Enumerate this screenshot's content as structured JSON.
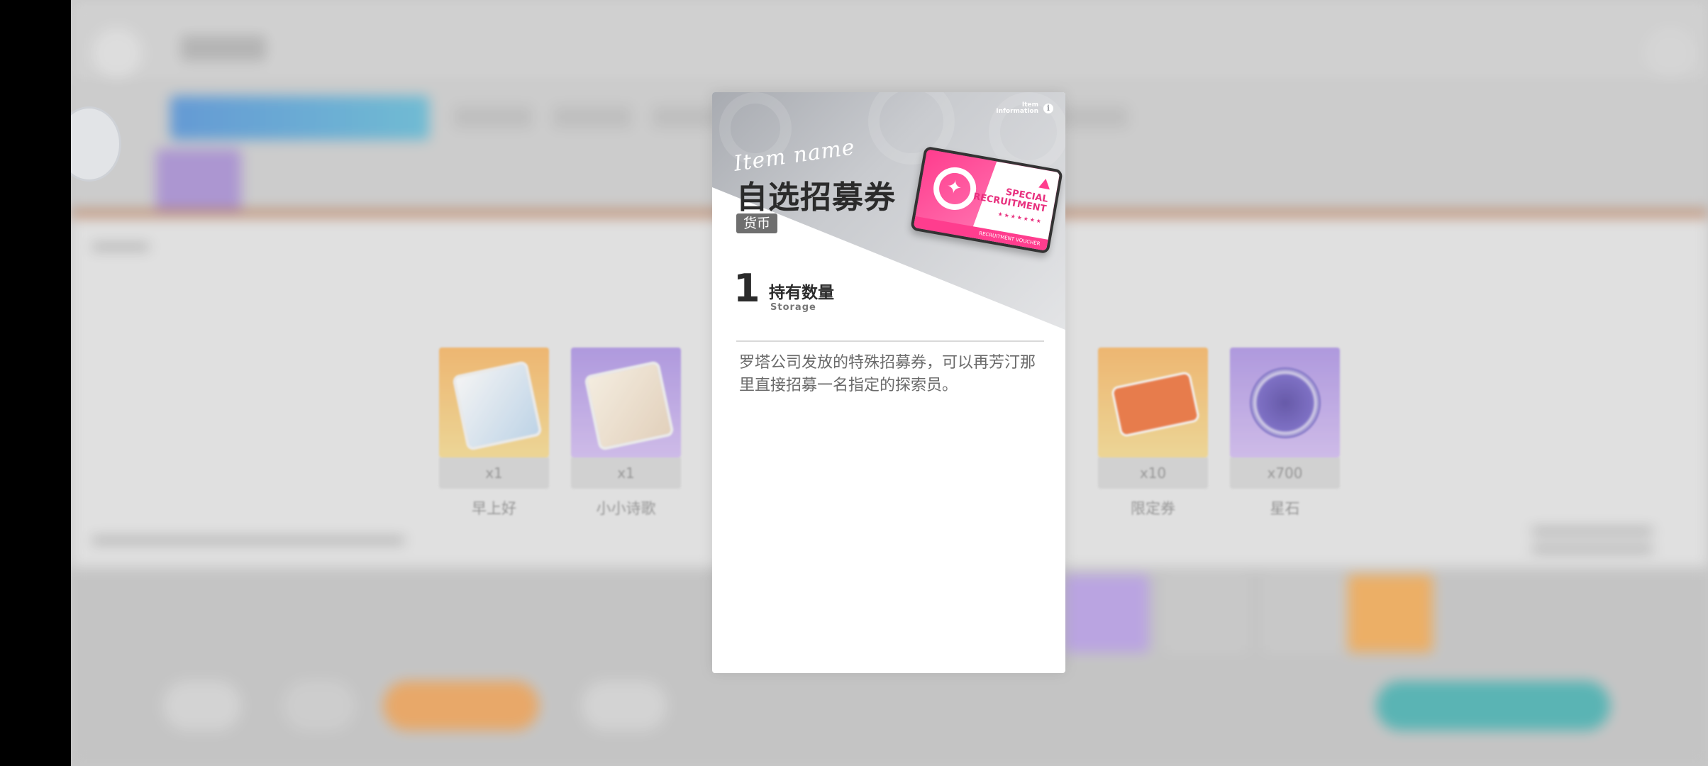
{
  "background_rewards": [
    {
      "qty": "x1",
      "name": "早上好",
      "tile_color": "#f5b85f",
      "art": "portrait-card"
    },
    {
      "qty": "x1",
      "name": "小小诗歌",
      "tile_color": "#b59be6",
      "art": "portrait-card"
    },
    {
      "qty": "x10",
      "name": "限定券",
      "tile_color": "#f7be63",
      "art": "ticket-icon"
    },
    {
      "qty": "x700",
      "name": "星石",
      "tile_color": "#b79ce8",
      "art": "star-coin-icon"
    }
  ],
  "item_card": {
    "info_label_line1": "Item",
    "info_label_line2": "Information",
    "info_icon": "i",
    "item_name_script": "Item name",
    "title": "自选招募券",
    "category": "货币",
    "ticket": {
      "text_line1": "SPECIAL",
      "text_line2": "RECRUITMENT",
      "stars": "★★★★★★★",
      "band_text": "RECRUITMENT VOUCHER",
      "icon": "star-magnifier-icon",
      "colors": {
        "pink": "#ff4f9c",
        "white": "#ffffff"
      }
    },
    "storage_count": "1",
    "storage_label": "持有数量",
    "storage_sub": "Storage",
    "description": "罗塔公司发放的特殊招募券，可以再芳汀那里直接招募一名指定的探索员。"
  },
  "colors": {
    "accent_blue": "#4c8fd8",
    "accent_orange": "#b8734a",
    "card_bg": "#ffffff",
    "title": "#2b2b2b"
  }
}
